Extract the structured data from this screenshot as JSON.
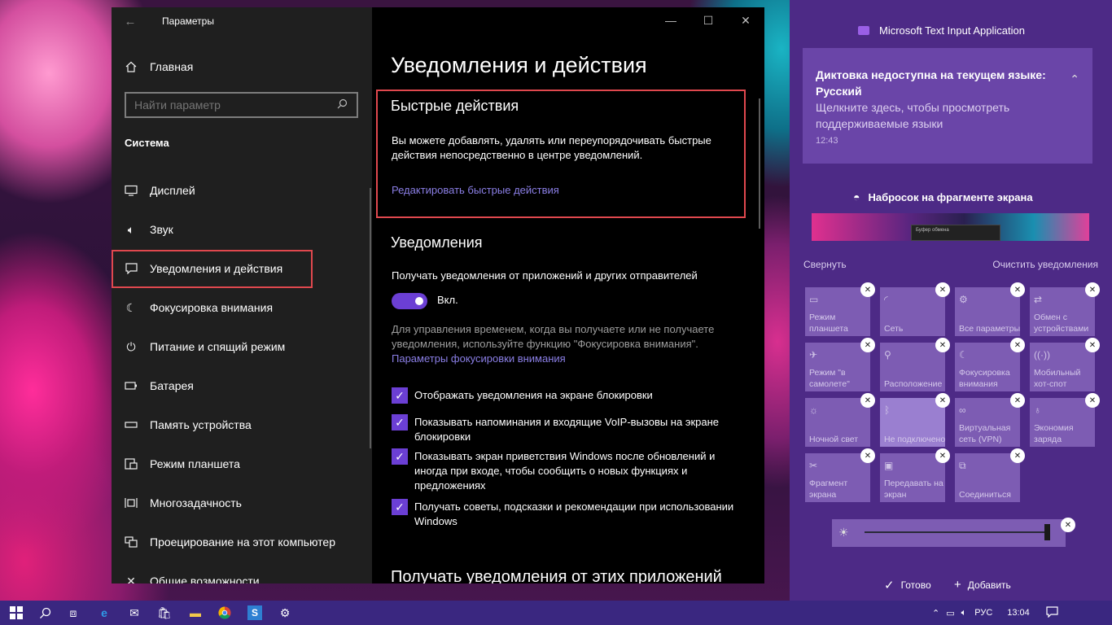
{
  "window": {
    "app_title": "Параметры",
    "home_label": "Главная",
    "search_placeholder": "Найти параметр",
    "section_label": "Система",
    "nav": [
      {
        "label": "Дисплей",
        "icon": "monitor-icon"
      },
      {
        "label": "Звук",
        "icon": "speaker-icon"
      },
      {
        "label": "Уведомления и действия",
        "icon": "message-icon"
      },
      {
        "label": "Фокусировка внимания",
        "icon": "moon-icon"
      },
      {
        "label": "Питание и спящий режим",
        "icon": "power-icon"
      },
      {
        "label": "Батарея",
        "icon": "battery-icon"
      },
      {
        "label": "Память устройства",
        "icon": "storage-icon"
      },
      {
        "label": "Режим планшета",
        "icon": "tablet-icon"
      },
      {
        "label": "Многозадачность",
        "icon": "multitask-icon"
      },
      {
        "label": "Проецирование на этот компьютер",
        "icon": "project-icon"
      },
      {
        "label": "Общие возможности",
        "icon": "shared-icon"
      }
    ]
  },
  "content": {
    "page_title": "Уведомления и действия",
    "quick_actions": {
      "heading": "Быстрые действия",
      "desc": "Вы можете добавлять, удалять или переупорядочивать быстрые действия непосредственно в центре уведомлений.",
      "link": "Редактировать быстрые действия"
    },
    "notifications": {
      "heading": "Уведомления",
      "toggle_title": "Получать уведомления от приложений и других отправителей",
      "toggle_state": "Вкл.",
      "toggle_on": true,
      "hint": "Для управления временем, когда вы получаете или не получаете уведомления, используйте функцию \"Фокусировка внимания\".",
      "focus_link": "Параметры фокусировки внимания",
      "checks": [
        "Отображать уведомления на экране блокировки",
        "Показывать напоминания и входящие VoIP-вызовы на экране блокировки",
        "Показывать экран приветствия Windows после обновлений и иногда при входе, чтобы сообщить о новых функциях и предложениях",
        "Получать советы, подсказки и рекомендации при использовании Windows"
      ]
    },
    "apps_heading": "Получать уведомления от этих приложений"
  },
  "action_center": {
    "app_name": "Microsoft Text Input Application",
    "toast": {
      "title": "Диктовка недоступна на текущем языке: Русский",
      "body": "Щелкните здесь, чтобы просмотреть поддерживаемые языки",
      "time": "12:43"
    },
    "snip_title": "Набросок на фрагменте экрана",
    "snip_caption": "Буфер обмена",
    "collapse": "Свернуть",
    "clear": "Очистить уведомления",
    "tiles": [
      {
        "label": "Режим планшета",
        "icon": "tablet-mode-icon",
        "active": false
      },
      {
        "label": "Сеть",
        "icon": "network-icon",
        "active": false
      },
      {
        "label": "Все параметры",
        "icon": "settings-icon",
        "active": false
      },
      {
        "label": "Обмен с устройствами",
        "icon": "share-icon",
        "active": false
      },
      {
        "label": "Режим \"в самолете\"",
        "icon": "airplane-icon",
        "active": false
      },
      {
        "label": "Расположение",
        "icon": "location-icon",
        "active": false
      },
      {
        "label": "Фокусировка внимания",
        "icon": "moon-icon",
        "active": false
      },
      {
        "label": "Мобильный хот-спот",
        "icon": "hotspot-icon",
        "active": false
      },
      {
        "label": "Ночной свет",
        "icon": "nightlight-icon",
        "active": false
      },
      {
        "label": "Не подключено",
        "icon": "bluetooth-icon",
        "active": true
      },
      {
        "label": "Виртуальная сеть (VPN)",
        "icon": "vpn-icon",
        "active": false
      },
      {
        "label": "Экономия заряда",
        "icon": "battery-saver-icon",
        "active": false
      },
      {
        "label": "Фрагмент экрана",
        "icon": "snip-icon",
        "active": false
      },
      {
        "label": "Передавать на экран",
        "icon": "project-icon",
        "active": false
      },
      {
        "label": "Соединиться",
        "icon": "connect-icon",
        "active": false
      }
    ],
    "brightness_level": 1.0,
    "done": "Готово",
    "add": "Добавить"
  },
  "taskbar": {
    "lang": "РУС",
    "time": "13:04"
  },
  "colors": {
    "accent": "#6b3fd4",
    "link": "#8b7fe6",
    "highlight": "#e0484e",
    "action_center_bg": "#4d2a86"
  }
}
